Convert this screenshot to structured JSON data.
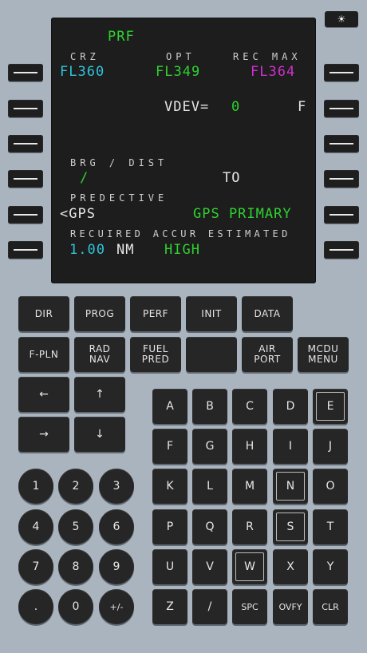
{
  "bright_key": "☀",
  "screen": {
    "title": "PRF",
    "crz_label": "CRZ",
    "opt_label": "OPT",
    "recmax_label": "REC MAX",
    "crz_value": "FL360",
    "opt_value": "FL349",
    "recmax_value": "FL364",
    "vdev_label": "VDEV=",
    "vdev_value": "0",
    "vdev_right": "F",
    "brgdist_label": "BRG / DIST",
    "brgdist_value": "/",
    "to_label": "TO",
    "predictive_label": "PREDECTIVE",
    "gps_left": "<GPS",
    "gps_primary": "GPS PRIMARY",
    "accur_label": "RECUIRED ACCUR ESTIMATED",
    "required_value": "1.00",
    "required_unit": "NM",
    "estimated_value": "HIGH"
  },
  "function_keys_row1": [
    "DIR",
    "PROG",
    "PERF",
    "INIT",
    "DATA"
  ],
  "function_keys_row2": [
    "F-PLN",
    "RAD\nNAV",
    "FUEL\nPRED",
    "",
    "AIR\nPORT",
    "MCDU\nMENU"
  ],
  "arrows": [
    "←",
    "↑",
    "→",
    "↓"
  ],
  "numbers": [
    "1",
    "2",
    "3",
    "4",
    "5",
    "6",
    "7",
    "8",
    "9",
    ".",
    "0",
    "+/-"
  ],
  "letters": [
    "A",
    "B",
    "C",
    "D",
    "E",
    "F",
    "G",
    "H",
    "I",
    "J",
    "K",
    "L",
    "M",
    "N",
    "O",
    "P",
    "Q",
    "R",
    "S",
    "T",
    "U",
    "V",
    "W",
    "X",
    "Y",
    "Z",
    "/",
    "SPC",
    "OVFY",
    "CLR"
  ]
}
